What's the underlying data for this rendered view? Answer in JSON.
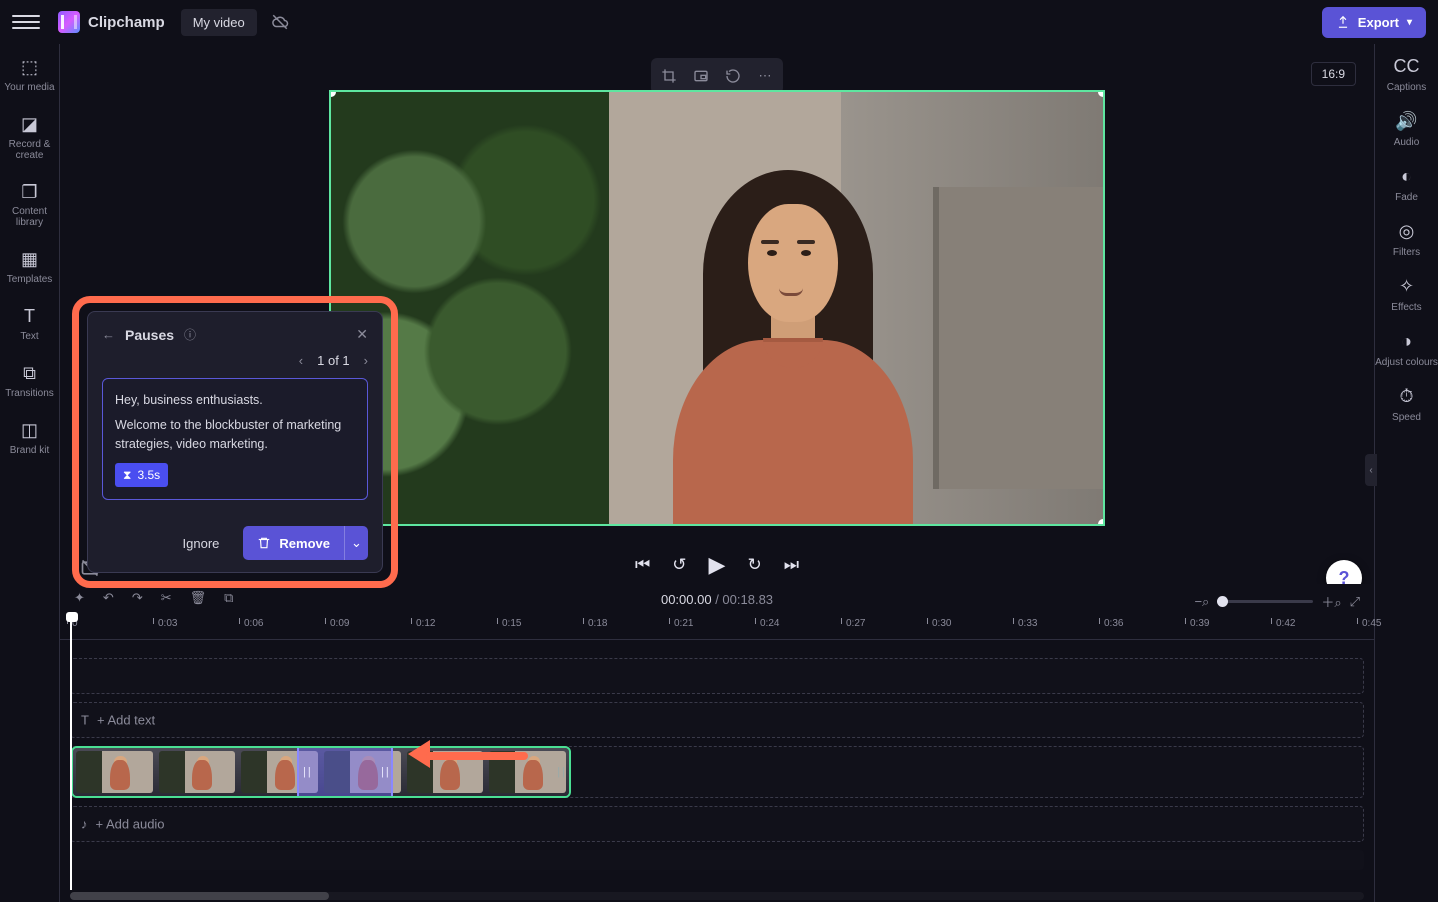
{
  "topbar": {
    "brand": "Clipchamp",
    "project": "My video",
    "export": "Export"
  },
  "leftrail": [
    {
      "id": "your-media",
      "label": "Your media"
    },
    {
      "id": "record-create",
      "label": "Record & create"
    },
    {
      "id": "content-library",
      "label": "Content library"
    },
    {
      "id": "templates",
      "label": "Templates"
    },
    {
      "id": "text",
      "label": "Text"
    },
    {
      "id": "transitions",
      "label": "Transitions"
    },
    {
      "id": "brand-kit",
      "label": "Brand kit"
    }
  ],
  "rightrail": [
    {
      "id": "captions",
      "label": "Captions"
    },
    {
      "id": "audio",
      "label": "Audio"
    },
    {
      "id": "fade",
      "label": "Fade"
    },
    {
      "id": "filters",
      "label": "Filters"
    },
    {
      "id": "effects",
      "label": "Effects"
    },
    {
      "id": "adjust-colours",
      "label": "Adjust colours"
    },
    {
      "id": "speed",
      "label": "Speed"
    }
  ],
  "preview": {
    "aspect": "16:9"
  },
  "popup": {
    "title": "Pauses",
    "pager": "1 of 1",
    "line1": "Hey, business enthusiasts.",
    "line2": "Welcome to the blockbuster of marketing strategies, video marketing.",
    "badge": "3.5s",
    "ignore": "Ignore",
    "remove": "Remove"
  },
  "timeline": {
    "current": "00:00.00",
    "total": "00:18.83",
    "ticks": [
      "0",
      "0:03",
      "0:06",
      "0:09",
      "0:12",
      "0:15",
      "0:18",
      "0:21",
      "0:24",
      "0:27",
      "0:30",
      "0:33",
      "0:36",
      "0:39",
      "0:42",
      "0:45"
    ],
    "addText": "+ Add text",
    "addAudio": "+ Add audio"
  }
}
